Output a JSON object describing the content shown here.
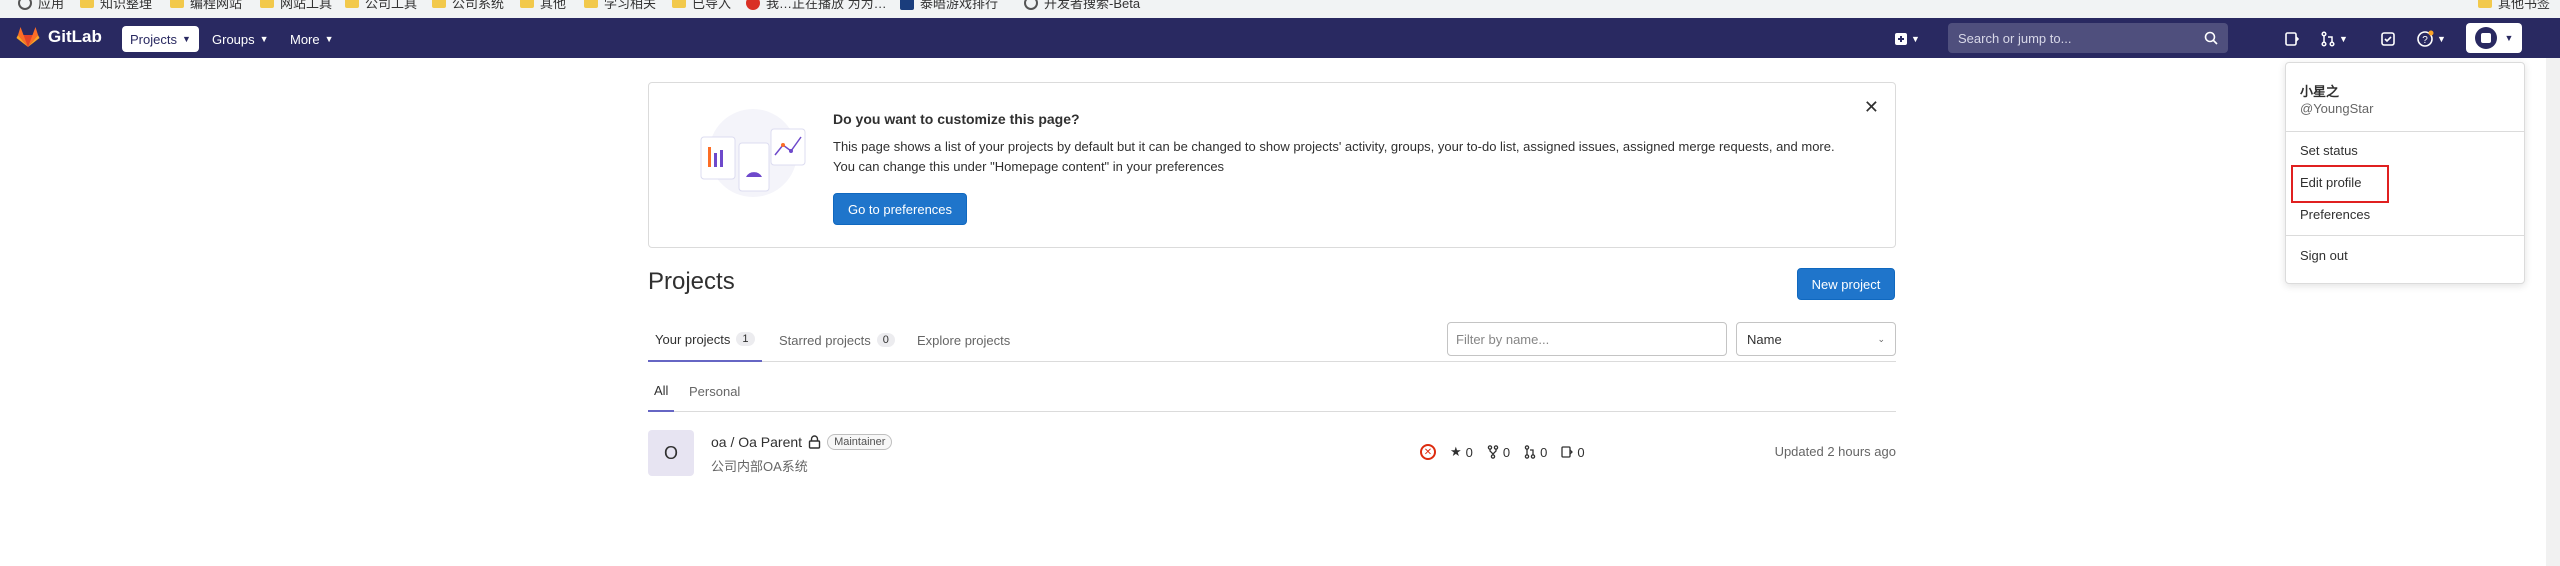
{
  "bookmarks": [
    "应用",
    "知识整理",
    "编程网站",
    "网站工具",
    "公司工具",
    "公司系统",
    "其他",
    "学习相关",
    "已导入",
    "我…正在播放 为为…",
    "泰晤游戏排行",
    "开发者搜索-Beta",
    "其他书签"
  ],
  "navbar": {
    "logo_text": "GitLab",
    "projects_label": "Projects",
    "groups_label": "Groups",
    "more_label": "More",
    "search_placeholder": "Search or jump to..."
  },
  "banner": {
    "title": "Do you want to customize this page?",
    "body": "This page shows a list of your projects by default but it can be changed to show projects' activity, groups, your to-do list, assigned issues, assigned merge requests, and more. You can change this under \"Homepage content\" in your preferences",
    "button_label": "Go to preferences",
    "close_symbol": "✕"
  },
  "page": {
    "title": "Projects",
    "new_project_label": "New project"
  },
  "tabs": [
    {
      "label": "Your projects",
      "count": "1"
    },
    {
      "label": "Starred projects",
      "count": "0"
    },
    {
      "label": "Explore projects",
      "count": ""
    }
  ],
  "filter": {
    "placeholder": "Filter by name...",
    "sort_value": "Name"
  },
  "subtabs": [
    "All",
    "Personal"
  ],
  "project": {
    "avatar_letter": "O",
    "name": "oa / Oa Parent",
    "role": "Maintainer",
    "description": "公司内部OA系统",
    "stars": "0",
    "forks": "0",
    "merge_requests": "0",
    "issues": "0",
    "updated": "Updated 2 hours ago",
    "pipeline_status": "failed"
  },
  "dropdown": {
    "display_name": "小星之",
    "username": "@YoungStar",
    "set_status": "Set status",
    "edit_profile": "Edit profile",
    "preferences": "Preferences",
    "sign_out": "Sign out"
  },
  "colors": {
    "navbar": "#292961",
    "primary": "#1f75cb",
    "highlight": "#e02020"
  }
}
